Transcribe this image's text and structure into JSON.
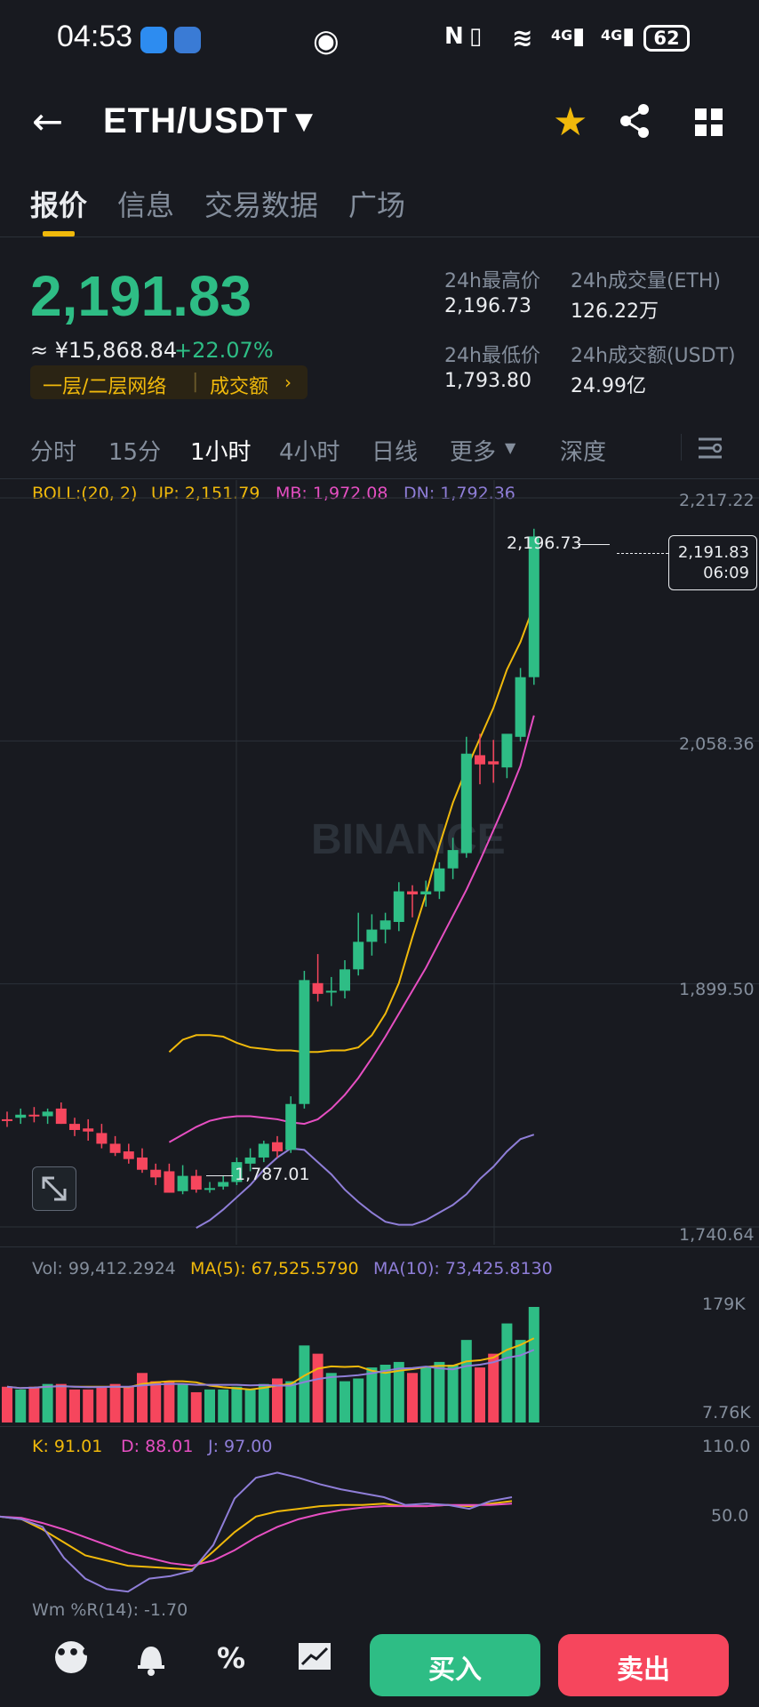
{
  "status_bar": {
    "time": "04:53",
    "network_1": "4G",
    "network_2": "4G",
    "battery": "62"
  },
  "header": {
    "pair": "ETH/USDT"
  },
  "tabs": [
    "报价",
    "信息",
    "交易数据",
    "广场"
  ],
  "price": {
    "last": "2,191.83",
    "cny": "≈ ¥15,868.84",
    "change": "+22.07%",
    "network_label": "一层/二层网络",
    "turnover_label": "成交额"
  },
  "stats": {
    "high_label": "24h最高价",
    "high": "2,196.73",
    "vol_label": "24h成交量(ETH)",
    "vol": "126.22万",
    "low_label": "24h最低价",
    "low": "1,793.80",
    "amt_label": "24h成交额(USDT)",
    "amt": "24.99亿"
  },
  "timeframes": [
    "分时",
    "15分",
    "1小时",
    "4小时",
    "日线",
    "更多",
    "深度"
  ],
  "boll": {
    "label": "BOLL:(20, 2)",
    "up": "UP: 2,151.79",
    "mb": "MB: 1,972.08",
    "dn": "DN: 1,792.36"
  },
  "price_axis": [
    "2,217.22",
    "2,058.36",
    "1,899.50",
    "1,740.64"
  ],
  "high_marker": "2,196.73",
  "low_marker": "1,787.01",
  "last_tag": {
    "price": "2,191.83",
    "countdown": "06:09"
  },
  "watermark": "BINANCE",
  "volume": {
    "vol": "Vol: 99,412.2924",
    "ma5": "MA(5): 67,525.5790",
    "ma10": "MA(10): 73,425.8130",
    "axis_top": "179K",
    "axis_bottom": "7.76K"
  },
  "kdj": {
    "k": "K: 91.01",
    "d": "D: 88.01",
    "j": "J: 97.00",
    "axis_top": "110.0",
    "axis_mid": "50.0"
  },
  "wr": {
    "label": "Wm %R(14): -1.70"
  },
  "actions": {
    "buy": "买入",
    "sell": "卖出"
  },
  "colors": {
    "up": "#2ebd85",
    "down": "#f6465d",
    "accent": "#f0b90b",
    "boll_up": "#f0b90b",
    "boll_mb": "#e64fc2",
    "boll_dn": "#8f7ed8"
  },
  "chart_data": {
    "type": "candlestick",
    "interval": "1小时",
    "y_range": [
      1740.64,
      2217.22
    ],
    "candles": [
      {
        "o": 1811,
        "h": 1816,
        "l": 1806,
        "c": 1810
      },
      {
        "o": 1812,
        "h": 1818,
        "l": 1808,
        "c": 1814
      },
      {
        "o": 1814,
        "h": 1819,
        "l": 1809,
        "c": 1813
      },
      {
        "o": 1813,
        "h": 1818,
        "l": 1808,
        "c": 1816
      },
      {
        "o": 1818,
        "h": 1822,
        "l": 1808,
        "c": 1808
      },
      {
        "o": 1808,
        "h": 1812,
        "l": 1800,
        "c": 1804
      },
      {
        "o": 1805,
        "h": 1811,
        "l": 1797,
        "c": 1803
      },
      {
        "o": 1802,
        "h": 1808,
        "l": 1792,
        "c": 1795
      },
      {
        "o": 1795,
        "h": 1800,
        "l": 1787,
        "c": 1789
      },
      {
        "o": 1790,
        "h": 1795,
        "l": 1782,
        "c": 1785
      },
      {
        "o": 1786,
        "h": 1792,
        "l": 1776,
        "c": 1778
      },
      {
        "o": 1778,
        "h": 1782,
        "l": 1768,
        "c": 1773
      },
      {
        "o": 1777,
        "h": 1782,
        "l": 1763,
        "c": 1763
      },
      {
        "o": 1764,
        "h": 1781,
        "l": 1762,
        "c": 1774
      },
      {
        "o": 1774,
        "h": 1778,
        "l": 1763,
        "c": 1765
      },
      {
        "o": 1765,
        "h": 1770,
        "l": 1763,
        "c": 1766
      },
      {
        "o": 1767,
        "h": 1774,
        "l": 1765,
        "c": 1770
      },
      {
        "o": 1770,
        "h": 1786,
        "l": 1768,
        "c": 1783
      },
      {
        "o": 1782,
        "h": 1792,
        "l": 1777,
        "c": 1786
      },
      {
        "o": 1786,
        "h": 1797,
        "l": 1783,
        "c": 1795
      },
      {
        "o": 1796,
        "h": 1800,
        "l": 1786,
        "c": 1790
      },
      {
        "o": 1791,
        "h": 1826,
        "l": 1789,
        "c": 1821
      },
      {
        "o": 1821,
        "h": 1908,
        "l": 1818,
        "c": 1902
      },
      {
        "o": 1900,
        "h": 1919,
        "l": 1888,
        "c": 1893
      },
      {
        "o": 1894,
        "h": 1904,
        "l": 1885,
        "c": 1895
      },
      {
        "o": 1895,
        "h": 1915,
        "l": 1890,
        "c": 1909
      },
      {
        "o": 1909,
        "h": 1946,
        "l": 1905,
        "c": 1927
      },
      {
        "o": 1927,
        "h": 1945,
        "l": 1918,
        "c": 1935
      },
      {
        "o": 1935,
        "h": 1946,
        "l": 1926,
        "c": 1941
      },
      {
        "o": 1940,
        "h": 1966,
        "l": 1934,
        "c": 1960
      },
      {
        "o": 1960,
        "h": 1964,
        "l": 1943,
        "c": 1958
      },
      {
        "o": 1958,
        "h": 1967,
        "l": 1950,
        "c": 1960
      },
      {
        "o": 1960,
        "h": 1979,
        "l": 1955,
        "c": 1975
      },
      {
        "o": 1975,
        "h": 1995,
        "l": 1968,
        "c": 1987
      },
      {
        "o": 1985,
        "h": 2061,
        "l": 1982,
        "c": 2050
      },
      {
        "o": 2049,
        "h": 2063,
        "l": 2030,
        "c": 2043
      },
      {
        "o": 2045,
        "h": 2059,
        "l": 2031,
        "c": 2043
      },
      {
        "o": 2041,
        "h": 2059,
        "l": 2034,
        "c": 2063
      },
      {
        "o": 2061,
        "h": 2106,
        "l": 2058,
        "c": 2100
      },
      {
        "o": 2100,
        "h": 2197,
        "l": 2095,
        "c": 2192
      }
    ],
    "boll_up": [
      1855,
      1863,
      1866,
      1866,
      1865,
      1861,
      1858,
      1857,
      1856,
      1856,
      1855,
      1855,
      1856,
      1856,
      1858,
      1866,
      1880,
      1900,
      1930,
      1958,
      1990,
      2018,
      2040,
      2060,
      2080,
      2105,
      2123,
      2147
    ],
    "boll_mb": [
      1796,
      1801,
      1806,
      1810,
      1812,
      1813,
      1813,
      1812,
      1811,
      1809,
      1808,
      1811,
      1818,
      1827,
      1838,
      1851,
      1865,
      1880,
      1895,
      1910,
      1927,
      1944,
      1961,
      1980,
      2000,
      2020,
      2042,
      2075
    ],
    "boll_dn": [
      1740,
      1745,
      1752,
      1760,
      1768,
      1778,
      1786,
      1792,
      1791,
      1783,
      1775,
      1765,
      1757,
      1750,
      1744,
      1742,
      1742,
      1745,
      1750,
      1755,
      1762,
      1772,
      1780,
      1790,
      1798,
      1801
    ],
    "volume": [
      13,
      12,
      13,
      14,
      14,
      12,
      12,
      13,
      14,
      13,
      18,
      15,
      15,
      14,
      11,
      12,
      12,
      13,
      12,
      14,
      16,
      15,
      28,
      25,
      18,
      15,
      16,
      20,
      21,
      22,
      18,
      20,
      22,
      21,
      30,
      20,
      25,
      36,
      30,
      42
    ],
    "kdj_k": [
      62,
      60,
      52,
      42,
      32,
      28,
      24,
      23,
      22,
      21,
      35,
      50,
      62,
      66,
      68,
      70,
      71,
      71,
      72,
      70,
      70,
      71,
      70,
      72,
      74
    ],
    "kdj_d": [
      62,
      61,
      57,
      52,
      46,
      40,
      34,
      30,
      26,
      24,
      28,
      36,
      46,
      54,
      60,
      64,
      67,
      69,
      70,
      70,
      70,
      71,
      71,
      71,
      72
    ],
    "kdj_j": [
      62,
      60,
      54,
      30,
      14,
      6,
      4,
      14,
      16,
      20,
      40,
      76,
      92,
      96,
      92,
      87,
      83,
      80,
      77,
      71,
      72,
      71,
      68,
      74,
      77
    ]
  }
}
